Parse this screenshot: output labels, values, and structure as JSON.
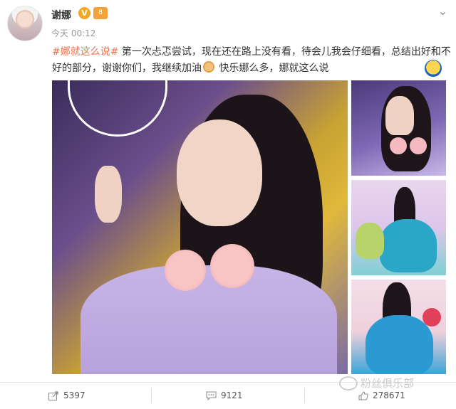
{
  "user": {
    "name": "谢娜",
    "verified_mark": "V",
    "level_badge": "8"
  },
  "post": {
    "time": "今天 00:12",
    "hashtag": "#娜就这么说#",
    "text_part1": " 第一次忐忑尝试，现在还在路上没有看，待会儿我会仔细看，总结出好和不好的部分，谢谢你们，我继续加油",
    "text_part2": "快乐娜么多，娜就这么说"
  },
  "actions": {
    "repost_count": "5397",
    "comment_count": "9121",
    "like_count": "278671"
  },
  "watermark": {
    "text": "粉丝俱乐部"
  },
  "colors": {
    "hashtag": "#eb7350",
    "verified": "#f5a623"
  }
}
